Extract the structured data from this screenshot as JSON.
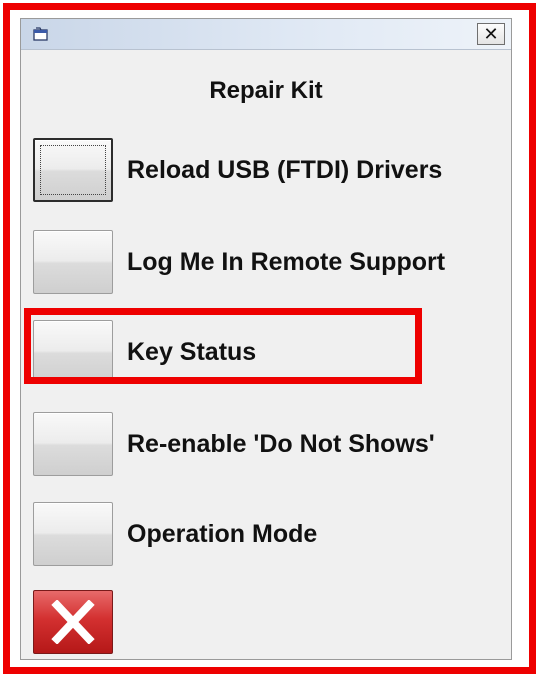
{
  "window": {
    "icon": "window-app-icon",
    "close_label": "✕"
  },
  "dialog": {
    "title": "Repair Kit"
  },
  "actions": [
    {
      "label": "Reload USB (FTDI) Drivers"
    },
    {
      "label": "Log Me In Remote Support"
    },
    {
      "label": "Key Status"
    },
    {
      "label": "Re-enable 'Do Not Shows'"
    },
    {
      "label": "Operation Mode"
    }
  ],
  "exit_button": {
    "icon": "red-x-icon"
  },
  "colors": {
    "highlight": "#ee0000",
    "window_bg": "#f0f0f0",
    "titlebar": "#dfe8f4",
    "exit_red": "#d33030"
  }
}
